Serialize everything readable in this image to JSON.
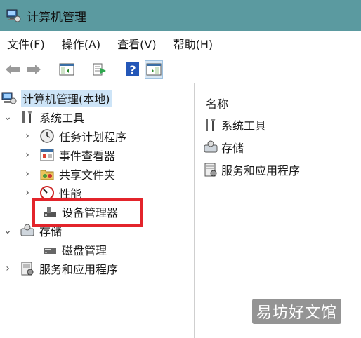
{
  "window": {
    "title": "计算机管理"
  },
  "menu": [
    "文件(F)",
    "操作(A)",
    "查看(V)",
    "帮助(H)"
  ],
  "toolbar": {
    "buttons": [
      "back-icon",
      "forward-icon",
      "show-hide-tree-icon",
      "export-list-icon",
      "help-icon",
      "action-pane-icon"
    ]
  },
  "tree": {
    "root": "计算机管理(本地)",
    "system_tools": "系统工具",
    "task_scheduler": "任务计划程序",
    "event_viewer": "事件查看器",
    "shared_folders": "共享文件夹",
    "performance": "性能",
    "device_manager": "设备管理器",
    "storage": "存储",
    "disk_management": "磁盘管理",
    "services_apps": "服务和应用程序"
  },
  "list": {
    "header": "名称",
    "items": [
      "系统工具",
      "存储",
      "服务和应用程序"
    ]
  },
  "watermark": "易坊好文馆",
  "colors": {
    "titlebar": "#5b9aa0",
    "highlight": "#e3242b",
    "selection": "#cde4f7"
  }
}
